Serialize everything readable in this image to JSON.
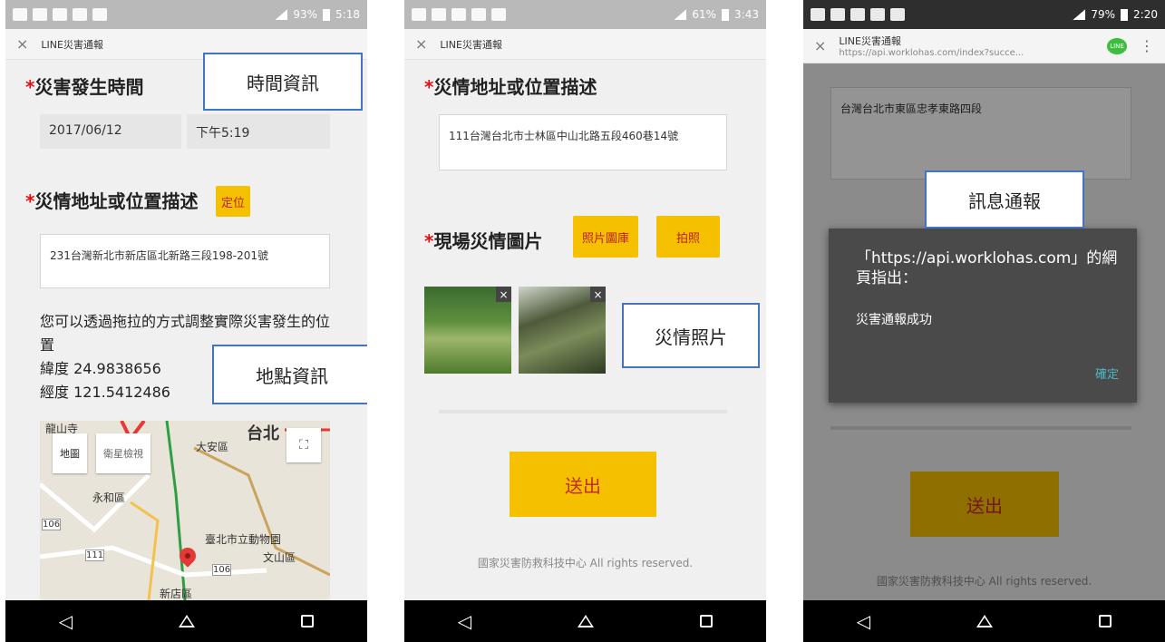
{
  "app_title": "LINE災害通報",
  "close_glyph": "×",
  "nav": {
    "back": "◁"
  },
  "phone1": {
    "status": {
      "battery": "93%",
      "time": "5:18"
    },
    "time_heading": "災害發生時間",
    "date": "2017/06/12",
    "time": "下午5:19",
    "address_heading": "災情地址或位置描述",
    "locate_button": "定位",
    "address_value": "231台灣新北市新店區北新路三段198-201號",
    "drag_note": "您可以透過拖拉的方式調整實際災害發生的位置",
    "latitude": "緯度 24.9838656",
    "longitude": "經度 121.5412486",
    "map": {
      "tab_map": "地圖",
      "tab_satellite": "衛星檢視",
      "labels": [
        "龍山寺",
        "台北",
        "大安區",
        "永和區",
        "臺北市立動物園",
        "文山區",
        "新店區",
        "106",
        "111",
        "106"
      ]
    },
    "callout_time": "時間資訊",
    "callout_place": "地點資訊"
  },
  "phone2": {
    "status": {
      "battery": "61%",
      "time": "3:43"
    },
    "address_heading": "災情地址或位置描述",
    "address_value": "111台灣台北市士林區中山北路五段460巷14號",
    "photo_heading": "現場災情圖片",
    "gallery_button": "照片圖庫",
    "camera_button": "拍照",
    "callout_photo": "災情照片",
    "submit": "送出",
    "footer": "國家災害防救科技中心 All rights reserved."
  },
  "phone3": {
    "status": {
      "battery": "79%",
      "time": "2:20"
    },
    "url": "https://api.worklohas.com/index?succe...",
    "line_badge": "LINE",
    "address_value": "台灣台北市東區忠孝東路四段",
    "callout_msg": "訊息通報",
    "dialog_title": "「https://api.worklohas.com」的網頁指出：",
    "dialog_msg": "災害通報成功",
    "dialog_ok": "確定",
    "submit": "送出",
    "footer": "國家災害防救科技中心 All rights reserved."
  }
}
